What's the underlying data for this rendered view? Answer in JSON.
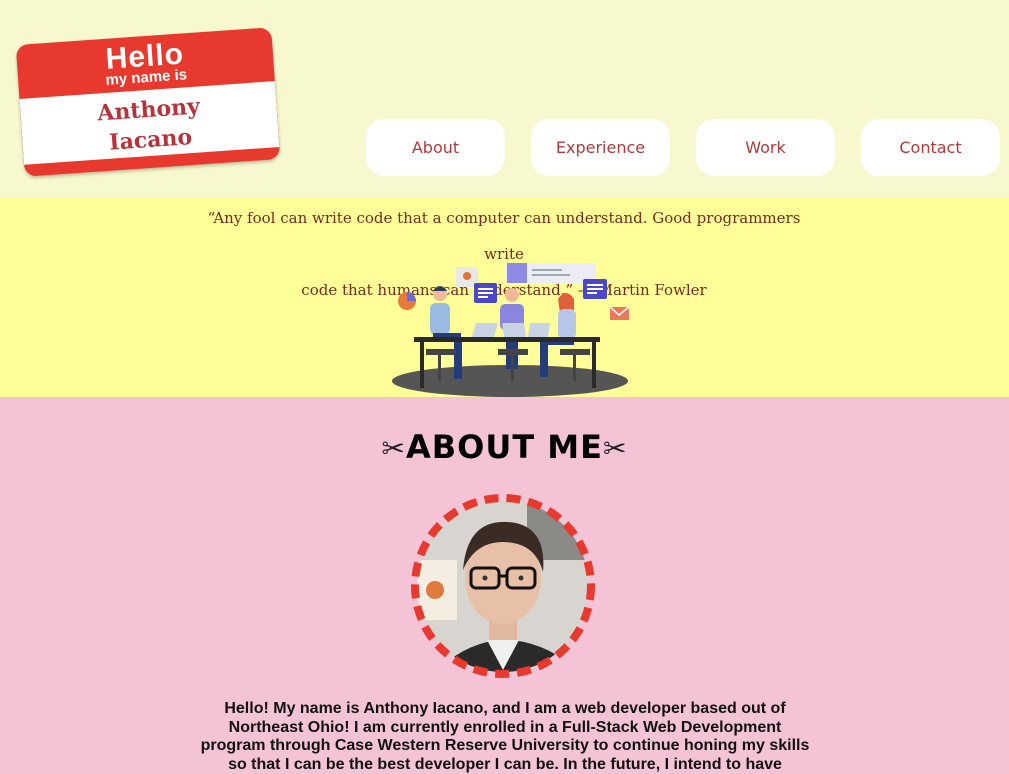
{
  "nametag": {
    "hello": "Hello",
    "sub": "my name is",
    "first_name": "Anthony",
    "last_name": "Iacano"
  },
  "nav": [
    {
      "label": "About"
    },
    {
      "label": "Experience"
    },
    {
      "label": "Work"
    },
    {
      "label": "Contact"
    }
  ],
  "quote": {
    "line1": "“Any fool can write code that a computer can understand. Good programmers write",
    "line2": "code that humans can understand.” — Martin Fowler"
  },
  "about": {
    "scissor_left": "✂",
    "title": "ABOUT ME",
    "scissor_right": "✂",
    "bio": "Hello! My name is Anthony Iacano, and I am a web developer based out of Northeast Ohio! I am currently enrolled in a Full-Stack Web Development program through Case Western Reserve University to continue honing my skills so that I can be the best developer I can be. In the future, I intend to have"
  },
  "colors": {
    "header_bg": "#f8f8ce",
    "banner_bg": "#ffff99",
    "about_bg": "#f4c3d6",
    "accent_red": "#e8392f",
    "nav_text": "#b03a3a"
  },
  "icons": [
    "scissors-icon",
    "team-illustration",
    "profile-photo"
  ]
}
